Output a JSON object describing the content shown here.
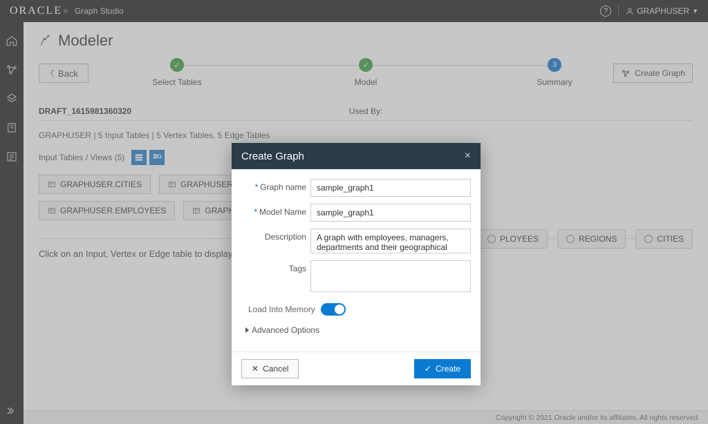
{
  "topbar": {
    "logo": "ORACLE",
    "product": "Graph Studio",
    "user": "GRAPHUSER"
  },
  "page": {
    "title": "Modeler",
    "back": "Back",
    "create_graph": "Create Graph"
  },
  "steps": {
    "s1": "Select Tables",
    "s2": "Model",
    "s3": "Summary",
    "s3_num": "3"
  },
  "summary": {
    "draft": "DRAFT_1615981360320",
    "usedby": "Used By:",
    "meta": "GRAPHUSER | 5 Input Tables | 5 Vertex Tables, 5 Edge Tables",
    "input_tables_label": "Input Tables / Views (5)",
    "hint": "Click on an Input, Vertex or Edge table to display further"
  },
  "input_pills": [
    "GRAPHUSER.CITIES",
    "GRAPHUSER.COUNTRIES",
    "GRAPHUSER.EMPLOYEES",
    "GRAPHUSER.REGION"
  ],
  "bg_pills": [
    "PLOYEES",
    "REGIONS",
    "CITIES"
  ],
  "modal": {
    "title": "Create Graph",
    "graph_name_label": "Graph name",
    "graph_name": "sample_graph1",
    "model_name_label": "Model Name",
    "model_name": "sample_graph1",
    "description_label": "Description",
    "description": "A graph with employees, managers, departments and their geographical locations.",
    "tags_label": "Tags",
    "tags": "",
    "load_mem": "Load Into Memory",
    "advanced": "Advanced Options",
    "cancel": "Cancel",
    "create": "Create"
  },
  "footer": "Copyright © 2021 Oracle and/or its affiliates. All rights reserved."
}
